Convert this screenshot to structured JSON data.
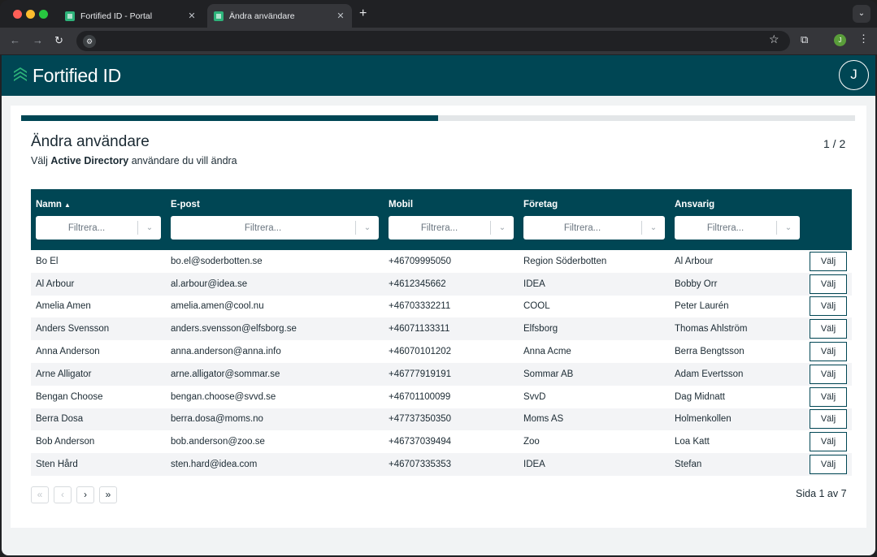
{
  "browser": {
    "tabs": [
      {
        "title": "Fortified ID - Portal",
        "active": false
      },
      {
        "title": "Ändra användare",
        "active": true
      }
    ],
    "new_tab": "+",
    "close_glyph": "✕",
    "profile_initial": "J"
  },
  "app": {
    "brand": "Fortified ID",
    "avatar_initial": "J",
    "accent_color": "#004654"
  },
  "page": {
    "title": "Ändra användare",
    "subtitle_prefix": "Välj",
    "subtitle_bold": "Active Directory",
    "subtitle_suffix": "användare du vill ändra",
    "step": "1 / 2",
    "progress_fraction": 0.5
  },
  "table": {
    "columns": [
      "Namn",
      "E-post",
      "Mobil",
      "Företag",
      "Ansvarig"
    ],
    "filter_placeholder": "Filtrera...",
    "action_label": "Välj",
    "rows": [
      [
        "Bo El",
        "bo.el@soderbotten.se",
        "+46709995050",
        "Region Söderbotten",
        "Al Arbour"
      ],
      [
        "Al Arbour",
        "al.arbour@idea.se",
        "+4612345662",
        "IDEA",
        "Bobby Orr"
      ],
      [
        "Amelia Amen",
        "amelia.amen@cool.nu",
        "+46703332211",
        "COOL",
        "Peter Laurén"
      ],
      [
        "Anders Svensson",
        "anders.svensson@elfsborg.se",
        "+46071133311",
        "Elfsborg",
        "Thomas Ahlström"
      ],
      [
        "Anna Anderson",
        "anna.anderson@anna.info",
        "+46070101202",
        "Anna Acme",
        "Berra Bengtsson"
      ],
      [
        "Arne Alligator",
        "arne.alligator@sommar.se",
        "+46777919191",
        "Sommar AB",
        "Adam Evertsson"
      ],
      [
        "Bengan Choose",
        "bengan.choose@svvd.se",
        "+46701100099",
        "SvvD",
        "Dag Midnatt"
      ],
      [
        "Berra Dosa",
        "berra.dosa@moms.no",
        "+47737350350",
        "Moms AS",
        "Holmenkollen"
      ],
      [
        "Bob Anderson",
        "bob.anderson@zoo.se",
        "+46737039494",
        "Zoo",
        "Loa Katt"
      ],
      [
        "Sten Hård",
        "sten.hard@idea.com",
        "+46707335353",
        "IDEA",
        "Stefan"
      ]
    ]
  },
  "pagination": {
    "first": "«",
    "prev": "‹",
    "next": "›",
    "last": "»",
    "info": "Sida 1 av 7"
  }
}
